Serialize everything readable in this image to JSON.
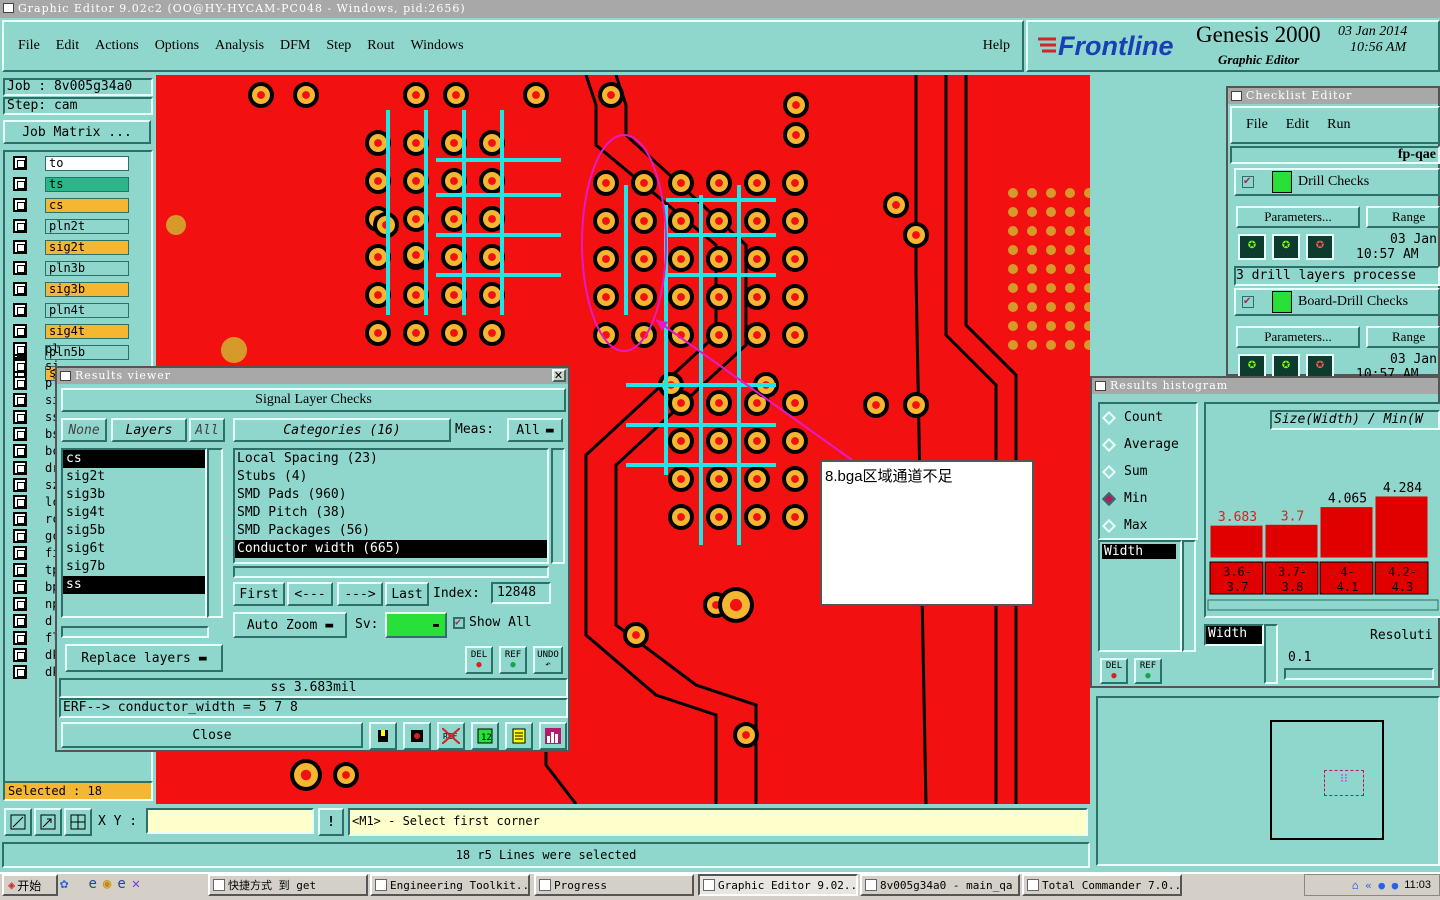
{
  "window_title": "Graphic Editor 9.02c2 (OO@HY-HYCAM-PC048 - Windows, pid:2656)",
  "menu": [
    "File",
    "Edit",
    "Actions",
    "Options",
    "Analysis",
    "DFM",
    "Step",
    "Rout",
    "Windows"
  ],
  "help": "Help",
  "brand": {
    "logo": "Frontline",
    "product": "Genesis 2000",
    "subtitle": "Graphic Editor",
    "date": "03 Jan 2014",
    "time": "10:56 AM"
  },
  "job": {
    "job_label": "Job : 8v005g34a0",
    "step_label": "Step: cam",
    "matrix_button": "Job Matrix ..."
  },
  "layers": [
    {
      "name": "to",
      "color": "#ffffff"
    },
    {
      "name": "ts",
      "color": "#2db58a"
    },
    {
      "name": "cs",
      "color": "#f5b731"
    },
    {
      "name": "pln2t",
      "color": "#8fd6cc"
    },
    {
      "name": "sig2t",
      "color": "#f5b731"
    },
    {
      "name": "pln3b",
      "color": "#8fd6cc"
    },
    {
      "name": "sig3b",
      "color": "#f5b731"
    },
    {
      "name": "pln4t",
      "color": "#8fd6cc"
    },
    {
      "name": "sig4t",
      "color": "#f5b731"
    },
    {
      "name": "pln5b",
      "color": "#8fd6cc"
    },
    {
      "name": "sig5b",
      "color": "#f5b731"
    }
  ],
  "layers_partial": [
    "pl",
    "si",
    "pl",
    "si",
    "ss",
    "bs",
    "bc",
    "dr",
    "sz",
    "lc",
    "rc",
    "gc",
    "fi",
    "tp",
    "bp",
    "np",
    "d",
    "fl",
    "dk",
    "dk"
  ],
  "selected_label": "Selected : 18",
  "results_viewer": {
    "title": "Results viewer",
    "header": "Signal Layer Checks",
    "none_btn": "None",
    "layers_btn": "Layers",
    "all_btn": "All",
    "layer_list": [
      "cs",
      "sig2t",
      "sig3b",
      "sig4t",
      "sig5b",
      "sig6t",
      "sig7b",
      "ss"
    ],
    "categories_label": "Categories (16)",
    "meas_label": "Meas:",
    "meas_value": "All",
    "categories": [
      "Local Spacing (23)",
      "Stubs (4)",
      "SMD Pads (960)",
      "SMD Pitch (38)",
      "SMD Packages (56)",
      "Conductor width (665)"
    ],
    "nav": {
      "first": "First",
      "prev": "<---",
      "next": "--->",
      "last": "Last",
      "index_label": "Index:",
      "index_value": "12848"
    },
    "auto_zoom": "Auto Zoom",
    "sv_label": "Sv:",
    "show_all": "Show All",
    "replace_layers": "Replace layers",
    "btn_del": "DEL",
    "btn_ref": "REF",
    "btn_undo": "UNDO",
    "measure": "ss 3.683mil",
    "erf": "ERF--> conductor_width = 5 7 8",
    "close": "Close"
  },
  "annotation": "8.bga区域通道不足",
  "checklist": {
    "title": "Checklist Editor",
    "menu": [
      "File",
      "Edit",
      "Run"
    ],
    "name": "fp-qae",
    "items": [
      {
        "name": "Drill Checks",
        "params": "Parameters...",
        "range": "Range",
        "date": "03 Jan",
        "time": "10:57 AM",
        "status": "3 drill layers processe"
      },
      {
        "name": "Board-Drill Checks",
        "params": "Parameters...",
        "range": "Range",
        "date": "03 Jan",
        "time": "10:57 AM"
      }
    ]
  },
  "histogram": {
    "title": "Results histogram",
    "options": [
      "Count",
      "Average",
      "Sum",
      "Min",
      "Max"
    ],
    "selected_option": "Min",
    "chart_title": "Size(Width) / Min(W",
    "list_item": "Width",
    "list_item2": "Width",
    "resolution_label": "Resoluti",
    "resolution_value": "0.1",
    "btn_del": "DEL",
    "btn_ref": "REF"
  },
  "chart_data": {
    "type": "bar",
    "categories": [
      "3.6-3.7",
      "3.7-3.8",
      "4-4.1",
      "4.2-4.3"
    ],
    "values": [
      3.683,
      3.7,
      4.065,
      4.284
    ],
    "value_labels": [
      "3.683",
      "3.7",
      "4.065",
      "4.284"
    ],
    "category_labels_top": [
      "3.6-",
      "3.7-",
      "4-",
      "4.2-"
    ],
    "category_labels_bottom": [
      "3.7",
      "3.8",
      "4.1",
      "4.3"
    ],
    "bar_color": "#e00000"
  },
  "statusbar": {
    "xy_label": "X Y :",
    "prompt": "<M1> - Select first corner",
    "message": "18 r5 Lines were selected"
  },
  "taskbar": {
    "start": "开始",
    "tasks": [
      "快捷方式 到 get",
      "Engineering Toolkit...",
      "Progress",
      "Graphic Editor 9.02...",
      "8v005g34a0 - main_qa",
      "Total Commander 7.0..."
    ],
    "clock": "11:03"
  }
}
